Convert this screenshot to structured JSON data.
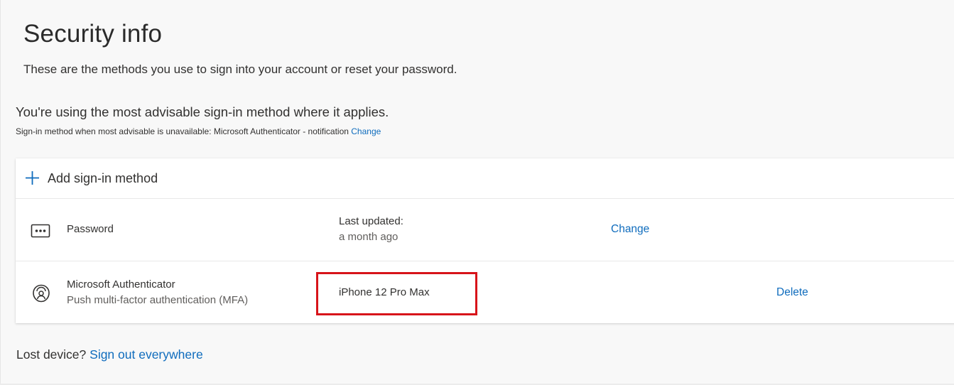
{
  "header": {
    "title": "Security info",
    "subtitle": "These are the methods you use to sign into your account or reset your password."
  },
  "default_method": {
    "heading": "You're using the most advisable sign-in method where it applies.",
    "description": "Sign-in method when most advisable is unavailable: Microsoft Authenticator - notification",
    "change_label": "Change"
  },
  "methods_card": {
    "add_label": "Add sign-in method",
    "add_icon": "plus-icon",
    "methods": [
      {
        "icon": "password-dots-icon",
        "name": "Password",
        "detail_label": "Last updated:",
        "detail_value": "a month ago",
        "action": "Change"
      },
      {
        "icon": "authenticator-lock-icon",
        "name": "Microsoft Authenticator",
        "subtext": "Push multi-factor authentication (MFA)",
        "detail_label": "iPhone 12 Pro Max",
        "action": "Delete"
      }
    ]
  },
  "footer": {
    "lost_device_label": "Lost device?",
    "sign_out_label": "Sign out everywhere"
  },
  "colors": {
    "link": "#0f6cbd",
    "highlight": "#d7141a",
    "background": "#f8f8f8"
  }
}
